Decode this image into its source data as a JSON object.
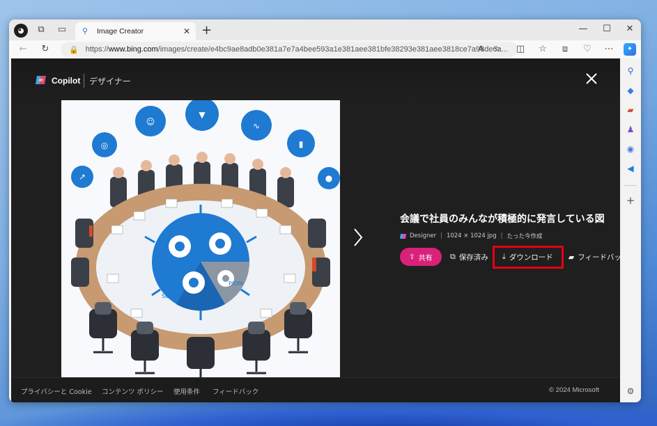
{
  "tab": {
    "title": "Image Creator"
  },
  "address_bar": {
    "url_prefix": "https://",
    "url_host": "www.bing.com",
    "url_path": "/images/create/e4bc9ae8adb0e381a7e7a4bee593a1e381aee381bfe38293e381aee3818ce7a98de6a..."
  },
  "viewer": {
    "brand": "Copilot",
    "section": "デザイナー",
    "image_title": "会議で社員のみんなが積極的に発言している図",
    "meta": {
      "source": "Designer",
      "dimensions": "1024 × 1024 jpg",
      "created": "たった今作成"
    },
    "actions": {
      "share": "共有",
      "saved": "保存済み",
      "download": "ダウンロード",
      "feedback": "フィードバッ"
    }
  },
  "footer": {
    "links": [
      "プライバシーと Cookie",
      "コンテンツ ポリシー",
      "使用条件",
      "フィードバック"
    ],
    "copyright": "© 2024 Microsoft"
  },
  "image_text": {
    "label_left": "Sosum",
    "label_right": "PIOM"
  },
  "colors": {
    "share": "#d9217a",
    "highlight": "#e60012",
    "accent_blue": "#1f7ad1"
  }
}
